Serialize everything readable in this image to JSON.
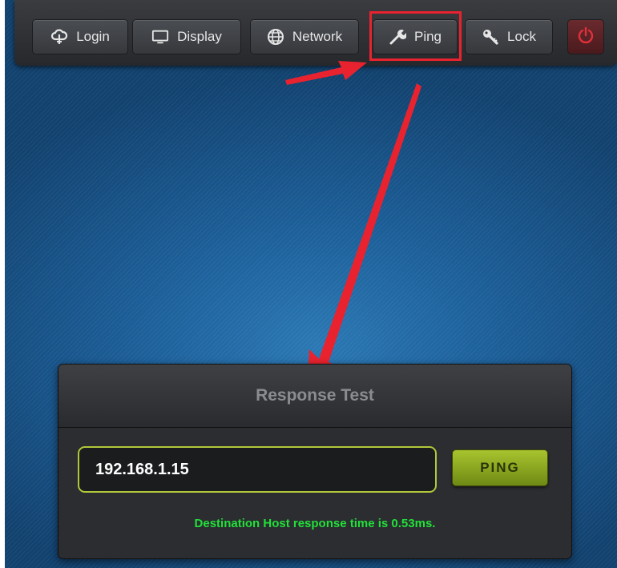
{
  "toolbar": {
    "buttons": [
      {
        "label": "Login",
        "icon": "cloud-icon"
      },
      {
        "label": "Display",
        "icon": "monitor-icon"
      },
      {
        "label": "Network",
        "icon": "globe-icon"
      },
      {
        "label": "Ping",
        "icon": "wrench-icon"
      },
      {
        "label": "Lock",
        "icon": "key-icon"
      }
    ],
    "power_icon": "power-icon"
  },
  "panel": {
    "title": "Response Test",
    "ip_value": "192.168.1.15",
    "ping_label": "PING",
    "result": "Destination Host response time is 0.53ms."
  },
  "colors": {
    "annotation": "#e8232f",
    "accent_green": "#a8c42e",
    "result_text": "#22e03a",
    "power": "#e0303a"
  }
}
